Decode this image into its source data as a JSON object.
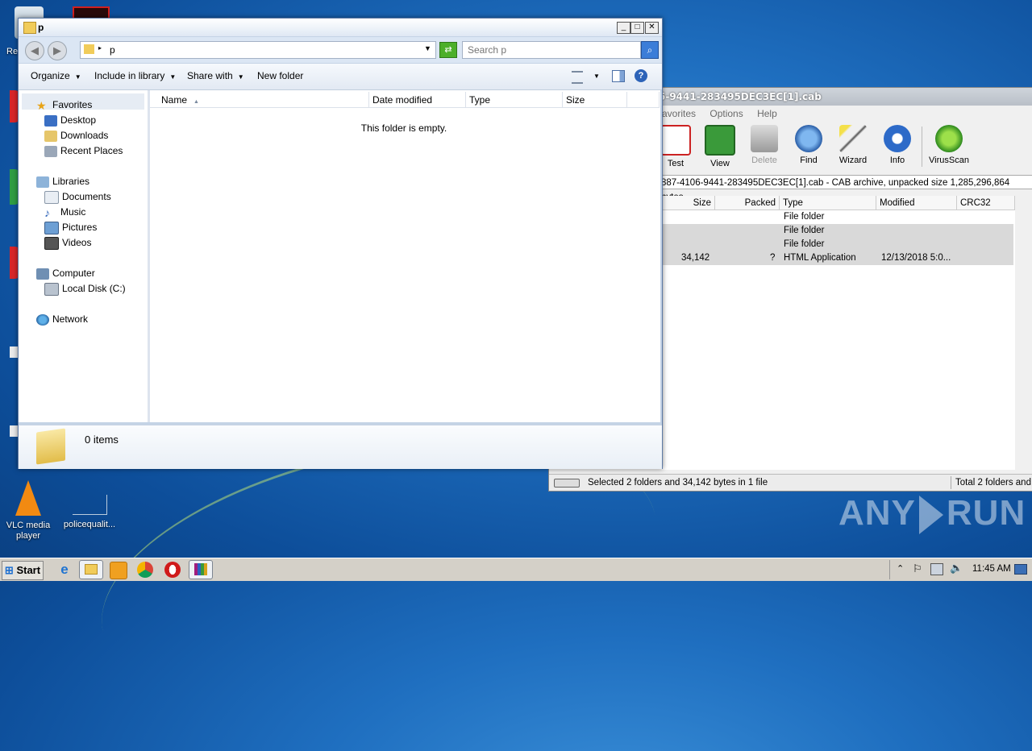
{
  "desktop": {
    "icons": [
      {
        "label": "VLC media player"
      },
      {
        "label": "policequalit..."
      }
    ],
    "partial_labels": [
      "Re"
    ],
    "watermark": "ANY RUN"
  },
  "winrar": {
    "title": "5-9441-283495DEC3EC[1].cab",
    "menu": [
      "avorites",
      "Options",
      "Help"
    ],
    "tools": [
      "Test",
      "View",
      "Delete",
      "Find",
      "Wizard",
      "Info",
      "VirusScan"
    ],
    "path": "887-4106-9441-283495DEC3EC[1].cab - CAB archive, unpacked size 1,285,296,864 bytes",
    "columns": [
      "Size",
      "Packed",
      "Type",
      "Modified",
      "CRC32"
    ],
    "rows": [
      {
        "size": "",
        "packed": "",
        "type": "File folder",
        "modified": ""
      },
      {
        "size": "",
        "packed": "",
        "type": "File folder",
        "modified": ""
      },
      {
        "size": "",
        "packed": "",
        "type": "File folder",
        "modified": ""
      },
      {
        "size": "34,142",
        "packed": "?",
        "type": "HTML Application",
        "modified": "12/13/2018 5:0..."
      }
    ],
    "status_left": "Selected 2 folders and 34,142 bytes in 1 file",
    "status_right": "Total 2 folders and 3"
  },
  "explorer": {
    "title": "p",
    "address": "p",
    "search_placeholder": "Search p",
    "commands": [
      "Organize",
      "Include in library",
      "Share with",
      "New folder"
    ],
    "nav": {
      "favorites": "Favorites",
      "favorites_items": [
        "Desktop",
        "Downloads",
        "Recent Places"
      ],
      "libraries": "Libraries",
      "libraries_items": [
        "Documents",
        "Music",
        "Pictures",
        "Videos"
      ],
      "computer": "Computer",
      "computer_items": [
        "Local Disk (C:)"
      ],
      "network": "Network"
    },
    "columns": [
      "Name",
      "Date modified",
      "Type",
      "Size"
    ],
    "empty_message": "This folder is empty.",
    "item_count": "0 items"
  },
  "taskbar": {
    "start": "Start",
    "clock": "11:45 AM"
  },
  "colors": {
    "desktop": "#1f6fc0",
    "taskbar": "#d4d0c8",
    "accent": "#3b7dd8"
  }
}
